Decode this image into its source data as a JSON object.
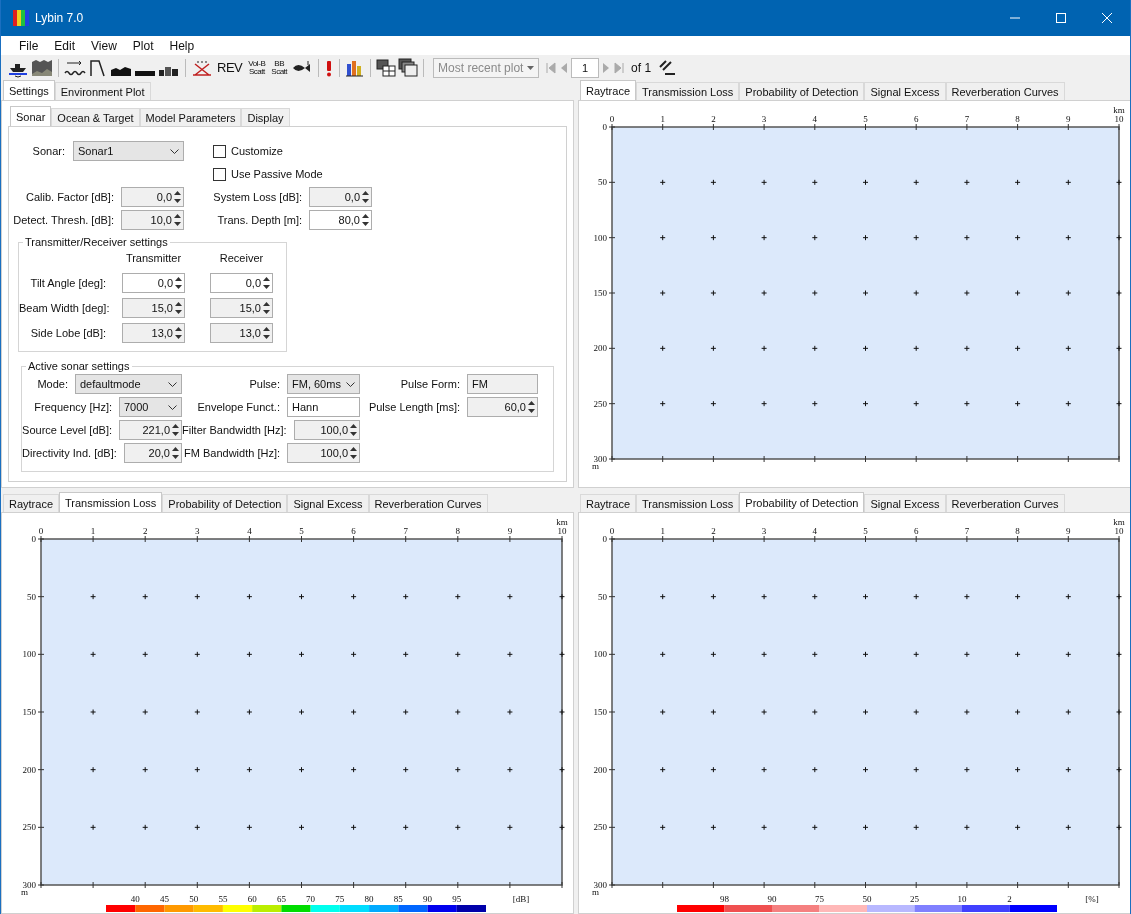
{
  "window": {
    "title": "Lybin 7.0"
  },
  "menu": [
    "File",
    "Edit",
    "View",
    "Plot",
    "Help"
  ],
  "toolbar": {
    "text_buttons": [
      {
        "lines": [
          "REV"
        ]
      },
      {
        "lines": [
          "VoI-B",
          "Scatt"
        ]
      },
      {
        "lines": [
          "BB",
          "Scatt"
        ]
      }
    ],
    "plot_select": {
      "value": "Most recent plot",
      "disabled": true
    },
    "navigation": {
      "disabled": true
    },
    "page": "1",
    "page_total": "of 1"
  },
  "settings": {
    "tabs": [
      {
        "label": "Settings",
        "selected": true
      },
      {
        "label": "Environment Plot",
        "selected": false
      }
    ],
    "subtabs": [
      {
        "label": "Sonar",
        "selected": true
      },
      {
        "label": "Ocean & Target",
        "selected": false
      },
      {
        "label": "Model Parameters",
        "selected": false
      },
      {
        "label": "Display",
        "selected": false
      }
    ],
    "sonar": {
      "label": "Sonar:",
      "value": "Sonar1"
    },
    "checkboxes": [
      {
        "label": "Customize",
        "checked": false
      },
      {
        "label": "Use Passive Mode",
        "checked": false
      }
    ],
    "fields": [
      {
        "label": "Calib. Factor [dB]:",
        "value": "0,0",
        "disabled": true
      },
      {
        "label": "System Loss [dB]:",
        "value": "0,0",
        "disabled": true
      },
      {
        "label": "Detect. Thresh. [dB]:",
        "value": "10,0",
        "disabled": true
      },
      {
        "label": "Trans. Depth [m]:",
        "value": "80,0",
        "disabled": false
      }
    ],
    "tx_rx": {
      "title": "Transmitter/Receiver settings",
      "columns": [
        "Transmitter",
        "Receiver"
      ],
      "rows": [
        {
          "label": "Tilt Angle [deg]:",
          "values": [
            {
              "value": "0,0",
              "disabled": false
            },
            {
              "value": "0,0",
              "disabled": false
            }
          ]
        },
        {
          "label": "Beam Width [deg]:",
          "values": [
            {
              "value": "15,0",
              "disabled": true
            },
            {
              "value": "15,0",
              "disabled": true
            }
          ]
        },
        {
          "label": "Side Lobe [dB]:",
          "values": [
            {
              "value": "13,0",
              "disabled": true
            },
            {
              "value": "13,0",
              "disabled": true
            }
          ]
        }
      ]
    },
    "active": {
      "title": "Active sonar settings",
      "rows": [
        [
          {
            "label": "Mode:",
            "kind": "dropdown",
            "value": "defaultmode"
          },
          {
            "label": "Pulse:",
            "kind": "dropdown",
            "value": "FM, 60ms"
          },
          {
            "label": "Pulse Form:",
            "kind": "text",
            "value": "FM",
            "disabled": true
          }
        ],
        [
          {
            "label": "Frequency [Hz]:",
            "kind": "dropdown",
            "value": "7000"
          },
          {
            "label": "Envelope Funct.:",
            "kind": "text",
            "value": "Hann",
            "disabled": false
          },
          {
            "label": "Pulse Length [ms]:",
            "kind": "spin",
            "value": "60,0",
            "disabled": true
          }
        ],
        [
          {
            "label": "Source Level [dB]:",
            "kind": "spin",
            "value": "221,0",
            "disabled": true
          },
          {
            "label": "Filter Bandwidth [Hz]:",
            "kind": "spin",
            "value": "100,0",
            "disabled": true
          }
        ],
        [
          {
            "label": "Directivity Ind. [dB]:",
            "kind": "spin",
            "value": "20,0",
            "disabled": true
          },
          {
            "label": "FM Bandwidth [Hz]:",
            "kind": "spin",
            "value": "100,0",
            "disabled": true
          }
        ]
      ]
    }
  },
  "plots": [
    {
      "tabs": [
        {
          "label": "Raytrace",
          "selected": true
        },
        {
          "label": "Transmission Loss",
          "selected": false
        },
        {
          "label": "Probability of Detection",
          "selected": false
        },
        {
          "label": "Signal Excess",
          "selected": false
        },
        {
          "label": "Reverberation Curves",
          "selected": false
        }
      ],
      "x_axis": {
        "ticks": [
          "0",
          "1",
          "2",
          "3",
          "4",
          "5",
          "6",
          "7",
          "8",
          "9",
          "10"
        ],
        "unit": "km"
      },
      "y_axis": {
        "ticks": [
          "0",
          "50",
          "100",
          "150",
          "200",
          "250",
          "300"
        ],
        "unit": "m"
      }
    },
    {
      "tabs": [
        {
          "label": "Raytrace",
          "selected": false
        },
        {
          "label": "Transmission Loss",
          "selected": true
        },
        {
          "label": "Probability of Detection",
          "selected": false
        },
        {
          "label": "Signal Excess",
          "selected": false
        },
        {
          "label": "Reverberation Curves",
          "selected": false
        }
      ],
      "x_axis": {
        "ticks": [
          "0",
          "1",
          "2",
          "3",
          "4",
          "5",
          "6",
          "7",
          "8",
          "9",
          "10"
        ],
        "unit": "km"
      },
      "y_axis": {
        "ticks": [
          "0",
          "50",
          "100",
          "150",
          "200",
          "250",
          "300"
        ],
        "unit": "m"
      },
      "legend": {
        "unit": "[dB]",
        "labels": [
          "40",
          "45",
          "50",
          "55",
          "60",
          "65",
          "70",
          "75",
          "80",
          "85",
          "90",
          "95"
        ],
        "swatches": [
          {
            "color": "#ff0000"
          },
          {
            "color": "#ff6600"
          },
          {
            "color": "#ff9900"
          },
          {
            "color": "#ffbb00"
          },
          {
            "color": "#ffff00"
          },
          {
            "color": "#bbee00"
          },
          {
            "color": "#00dd00"
          },
          {
            "color": "#00ffee"
          },
          {
            "color": "#00ddff"
          },
          {
            "color": "#00aaff"
          },
          {
            "color": "#0066ff"
          },
          {
            "color": "#0000ee"
          },
          {
            "color": "#0000aa"
          }
        ]
      }
    },
    {
      "tabs": [
        {
          "label": "Raytrace",
          "selected": false
        },
        {
          "label": "Transmission Loss",
          "selected": false
        },
        {
          "label": "Probability of Detection",
          "selected": true
        },
        {
          "label": "Signal Excess",
          "selected": false
        },
        {
          "label": "Reverberation Curves",
          "selected": false
        }
      ],
      "x_axis": {
        "ticks": [
          "0",
          "1",
          "2",
          "3",
          "4",
          "5",
          "6",
          "7",
          "8",
          "9",
          "10"
        ],
        "unit": "km"
      },
      "y_axis": {
        "ticks": [
          "0",
          "50",
          "100",
          "150",
          "200",
          "250",
          "300"
        ],
        "unit": "m"
      },
      "legend": {
        "unit": "[%]",
        "labels": [
          "98",
          "90",
          "75",
          "50",
          "25",
          "10",
          "2"
        ],
        "swatches": [
          {
            "color": "#ff0000"
          },
          {
            "color": "#f05050"
          },
          {
            "color": "#f58080"
          },
          {
            "color": "#ffb8b8"
          },
          {
            "color": "#b8b8ff"
          },
          {
            "color": "#8080ff"
          },
          {
            "color": "#4040ff"
          },
          {
            "color": "#0000ff"
          }
        ]
      }
    }
  ]
}
